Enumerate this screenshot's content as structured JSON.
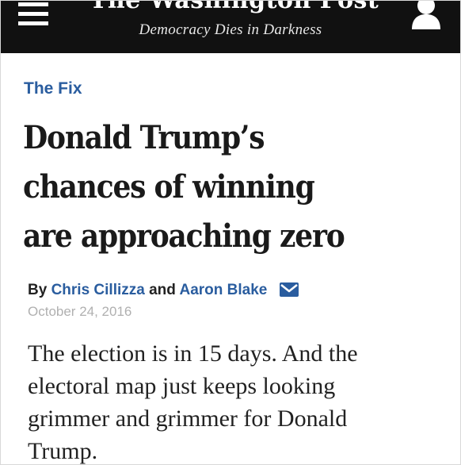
{
  "masthead": {
    "logo_text": "The Washington Post",
    "tagline": "Democracy Dies in Darkness",
    "menu_icon": "hamburger-menu-icon",
    "user_icon": "user-account-icon",
    "background": "#111111"
  },
  "article": {
    "section": "The Fix",
    "headline_lines": [
      "Donald Trump’s",
      "chances of winning",
      "are approaching zero"
    ],
    "byline": {
      "prefix": "By",
      "author1": "Chris Cillizza",
      "conjunction": "and",
      "author2": "Aaron Blake",
      "email_icon": "envelope-icon"
    },
    "date": "October 24, 2016",
    "body_lines": [
      "The election is in 15 days. And the",
      "electoral map just keeps looking",
      "grimmer and grimmer for Donald",
      "Trump."
    ],
    "link_color": "#2a5d9f"
  }
}
